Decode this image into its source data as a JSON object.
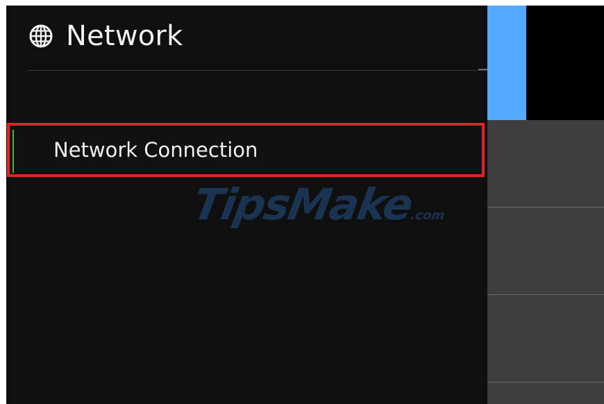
{
  "header": {
    "icon": "globe-icon",
    "title": "Network"
  },
  "menu": {
    "items": [
      {
        "label": "Network Connection",
        "selected": true
      }
    ]
  },
  "watermark": {
    "text": "TipsMake",
    "suffix": ".com"
  },
  "colors": {
    "background": "#0f0f0f",
    "accent_tile": "#55aaff",
    "highlight_border": "#e02424",
    "selection_marker": "#2fbf3a",
    "side_panel": "#3e3e3e"
  }
}
